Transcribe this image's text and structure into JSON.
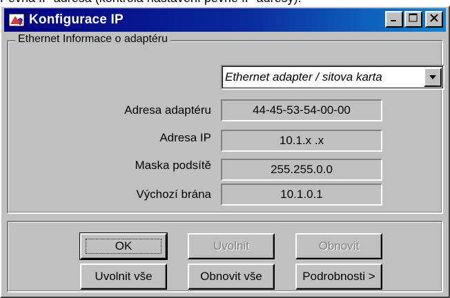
{
  "caption_text": "Pevná IP adresa (kontrola nastavení pevné IP adresy):",
  "window": {
    "title": "Konfigurace IP",
    "icon": "network-question-icon",
    "controls": {
      "minimize_icon": "minimize-icon",
      "maximize_icon": "maximize-icon",
      "close_icon": "close-icon"
    }
  },
  "adapter_group": {
    "legend": "Ethernet  Informace o adaptéru",
    "adapter_select": {
      "value": "Ethernet adapter / sitova karta",
      "arrow_icon": "dropdown-arrow-icon"
    },
    "rows": [
      {
        "label": "Adresa adaptéru",
        "value": "44-45-53-54-00-00"
      },
      {
        "label": "Adresa IP",
        "value": "10.1.x .x"
      },
      {
        "label": "Maska podsítě",
        "value": "255.255.0.0"
      },
      {
        "label": "Výchozí brána",
        "value": "10.1.0.1"
      }
    ]
  },
  "buttons": {
    "ok": "OK",
    "release": "Uvolnit",
    "renew": "Obnovit",
    "release_all": "Uvolnit vše",
    "renew_all": "Obnovit vše",
    "details": "Podrobnosti >"
  },
  "colors": {
    "titlebar_start": "#000080",
    "titlebar_end": "#1084d0",
    "window_face": "#c0c0c0",
    "disabled_text": "#808080"
  }
}
